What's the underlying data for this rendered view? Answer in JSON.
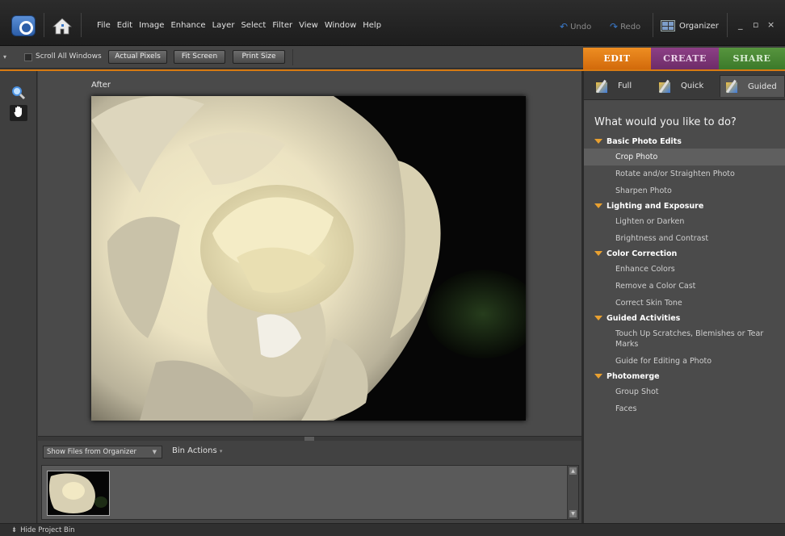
{
  "menubar": {
    "menus": [
      "File",
      "Edit",
      "Image",
      "Enhance",
      "Layer",
      "Select",
      "Filter",
      "View",
      "Window",
      "Help"
    ],
    "undo_label": "Undo",
    "redo_label": "Redo",
    "organizer_label": "Organizer",
    "minimize_glyph": "_",
    "maximize_glyph": "▫",
    "close_glyph": "×"
  },
  "options_bar": {
    "scroll_all_windows": "Scroll All Windows",
    "actual_pixels": "Actual Pixels",
    "fit_screen": "Fit Screen",
    "print_size": "Print Size"
  },
  "mode_tabs": {
    "edit": "EDIT",
    "create": "CREATE",
    "share": "SHARE",
    "active": "EDIT",
    "colors": {
      "edit": "#e27d17",
      "create": "#7d3577",
      "share": "#4a8a35"
    }
  },
  "tools": {
    "zoom_icon": "zoom-icon",
    "hand_icon": "hand-icon",
    "active": "hand"
  },
  "canvas": {
    "view_label": "After"
  },
  "project_bin": {
    "source_select": "Show Files from Organizer",
    "bin_actions": "Bin Actions",
    "hide_label": "Hide Project Bin"
  },
  "panel": {
    "subtabs": {
      "full": "Full",
      "quick": "Quick",
      "guided": "Guided",
      "active": "Guided"
    },
    "question": "What would you like to do?",
    "groups": [
      {
        "title": "Basic Photo Edits",
        "items": [
          "Crop Photo",
          "Rotate and/or Straighten Photo",
          "Sharpen Photo"
        ]
      },
      {
        "title": "Lighting and Exposure",
        "items": [
          "Lighten or Darken",
          "Brightness and Contrast"
        ]
      },
      {
        "title": "Color Correction",
        "items": [
          "Enhance Colors",
          "Remove a Color Cast",
          "Correct Skin Tone"
        ]
      },
      {
        "title": "Guided Activities",
        "items": [
          "Touch Up Scratches, Blemishes or Tear Marks",
          "Guide for Editing a Photo"
        ]
      },
      {
        "title": "Photomerge",
        "items": [
          "Group Shot",
          "Faces"
        ]
      }
    ],
    "selected_item": "Crop Photo"
  }
}
